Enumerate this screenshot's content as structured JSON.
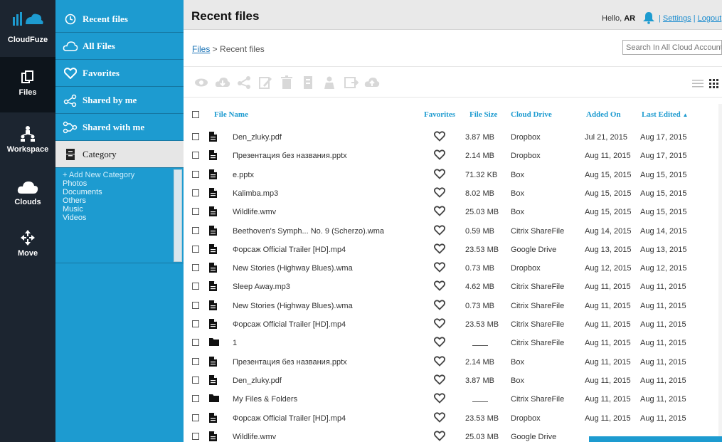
{
  "rail": {
    "brand": "CloudFuze",
    "items": [
      {
        "label": "Files",
        "icon": "files-icon"
      },
      {
        "label": "Workspace",
        "icon": "workspace-icon"
      },
      {
        "label": "Clouds",
        "icon": "cloud-icon"
      },
      {
        "label": "Move",
        "icon": "move-icon"
      }
    ]
  },
  "sidebar": {
    "items": [
      {
        "label": "Recent files",
        "icon": "clock-icon"
      },
      {
        "label": "All Files",
        "icon": "cloud-outline-icon"
      },
      {
        "label": "Favorites",
        "icon": "heart-icon"
      },
      {
        "label": "Shared by me",
        "icon": "share-icon"
      },
      {
        "label": "Shared with me",
        "icon": "shared-with-icon"
      },
      {
        "label": "Category",
        "icon": "cabinet-icon"
      }
    ],
    "categories": [
      "+ Add New Category",
      "Photos",
      "Documents",
      "Others",
      "Music",
      "Videos"
    ]
  },
  "header": {
    "title": "Recent files",
    "hello": "Hello,",
    "user": "AR",
    "settings": "Settings",
    "separator": " | ",
    "logout": "Logout"
  },
  "breadcrumb": {
    "root": "Files",
    "sep": " > ",
    "current": "Recent files"
  },
  "search": {
    "placeholder": "Search In All Cloud Accounts"
  },
  "toolbar": {
    "icons": [
      "preview-icon",
      "download-icon",
      "share-icon",
      "edit-icon",
      "delete-icon",
      "copy-icon",
      "user-icon",
      "move-icon",
      "upload-icon"
    ]
  },
  "table": {
    "columns": {
      "name": "File Name",
      "favorites": "Favorites",
      "size": "File Size",
      "drive": "Cloud Drive",
      "added": "Added On",
      "edited": "Last Edited",
      "sort_arrow": "▲"
    },
    "rows": [
      {
        "name": "Den_zluky.pdf",
        "type": "file",
        "size": "3.87 MB",
        "drive": "Dropbox",
        "added": "Jul 21, 2015",
        "edited": "Aug 17, 2015"
      },
      {
        "name": "Презентация без названия.pptx",
        "type": "file",
        "size": "2.14 MB",
        "drive": "Dropbox",
        "added": "Aug 11, 2015",
        "edited": "Aug 17, 2015"
      },
      {
        "name": "e.pptx",
        "type": "file",
        "size": "71.32 KB",
        "drive": "Box",
        "added": "Aug 15, 2015",
        "edited": "Aug 15, 2015"
      },
      {
        "name": "Kalimba.mp3",
        "type": "file",
        "size": "8.02 MB",
        "drive": "Box",
        "added": "Aug 15, 2015",
        "edited": "Aug 15, 2015"
      },
      {
        "name": "Wildlife.wmv",
        "type": "file",
        "size": "25.03 MB",
        "drive": "Box",
        "added": "Aug 15, 2015",
        "edited": "Aug 15, 2015"
      },
      {
        "name": "Beethoven's Symph... No. 9 (Scherzo).wma",
        "type": "file",
        "size": "0.59 MB",
        "drive": "Citrix ShareFile",
        "added": "Aug 14, 2015",
        "edited": "Aug 14, 2015"
      },
      {
        "name": "Форсаж Official Trailer [HD].mp4",
        "type": "file",
        "size": "23.53 MB",
        "drive": "Google Drive",
        "added": "Aug 13, 2015",
        "edited": "Aug 13, 2015"
      },
      {
        "name": "New Stories (Highway Blues).wma",
        "type": "file",
        "size": "0.73 MB",
        "drive": "Dropbox",
        "added": "Aug 12, 2015",
        "edited": "Aug 12, 2015"
      },
      {
        "name": "Sleep Away.mp3",
        "type": "file",
        "size": "4.62 MB",
        "drive": "Citrix ShareFile",
        "added": "Aug 11, 2015",
        "edited": "Aug 11, 2015"
      },
      {
        "name": "New Stories (Highway Blues).wma",
        "type": "file",
        "size": "0.73 MB",
        "drive": "Citrix ShareFile",
        "added": "Aug 11, 2015",
        "edited": "Aug 11, 2015"
      },
      {
        "name": "Форсаж Official Trailer [HD].mp4",
        "type": "file",
        "size": "23.53 MB",
        "drive": "Citrix ShareFile",
        "added": "Aug 11, 2015",
        "edited": "Aug 11, 2015"
      },
      {
        "name": "1",
        "type": "folder",
        "size": "",
        "drive": "Citrix ShareFile",
        "added": "Aug 11, 2015",
        "edited": "Aug 11, 2015"
      },
      {
        "name": "Презентация без названия.pptx",
        "type": "file",
        "size": "2.14 MB",
        "drive": "Box",
        "added": "Aug 11, 2015",
        "edited": "Aug 11, 2015"
      },
      {
        "name": "Den_zluky.pdf",
        "type": "file",
        "size": "3.87 MB",
        "drive": "Box",
        "added": "Aug 11, 2015",
        "edited": "Aug 11, 2015"
      },
      {
        "name": "My Files & Folders",
        "type": "folder",
        "size": "",
        "drive": "Citrix ShareFile",
        "added": "Aug 11, 2015",
        "edited": "Aug 11, 2015"
      },
      {
        "name": "Форсаж Official Trailer [HD].mp4",
        "type": "file",
        "size": "23.53 MB",
        "drive": "Dropbox",
        "added": "Aug 11, 2015",
        "edited": "Aug 11, 2015"
      },
      {
        "name": "Wildlife.wmv",
        "type": "file",
        "size": "25.03 MB",
        "drive": "Google Drive",
        "added": "",
        "edited": ""
      }
    ]
  },
  "colors": {
    "rail": "#1c2530",
    "sidebar": "#1d9bd0",
    "accent": "#1d9bd0",
    "link": "#1a73b6"
  }
}
